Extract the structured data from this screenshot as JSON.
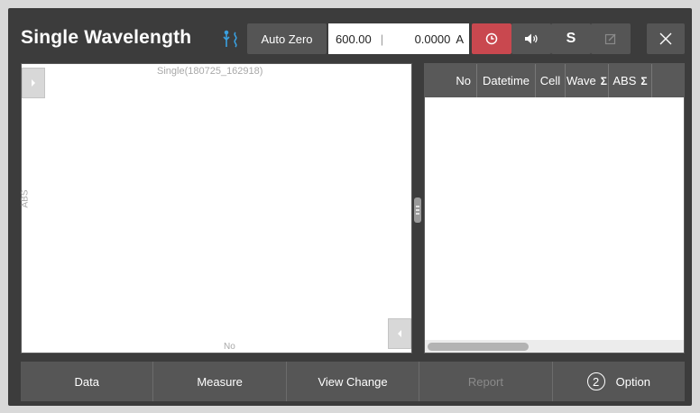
{
  "header": {
    "title": "Single Wavelength",
    "auto_zero_label": "Auto Zero",
    "wavelength_value": "600.00",
    "absorbance_value": "0.0000",
    "absorbance_unit": "A",
    "s_label": "S"
  },
  "chart": {
    "title": "Single(180725_162918)",
    "ylabel": "ABS",
    "xlabel": "No"
  },
  "table": {
    "columns": [
      "No",
      "Datetime",
      "Cell",
      "Wave",
      "ABS"
    ],
    "sigma": "Σ"
  },
  "bottom": {
    "data": "Data",
    "measure": "Measure",
    "view_change": "View Change",
    "report": "Report",
    "option_number": "2",
    "option": "Option"
  },
  "colors": {
    "background": "#3c3c3c",
    "accent_red": "#c9484f",
    "usb_icon": "#3aa0e0"
  },
  "icons": [
    "usb-icon",
    "timer-icon",
    "speaker-icon",
    "edit-icon",
    "close-icon",
    "expand-arrow-icon",
    "collapse-arrow-icon"
  ]
}
